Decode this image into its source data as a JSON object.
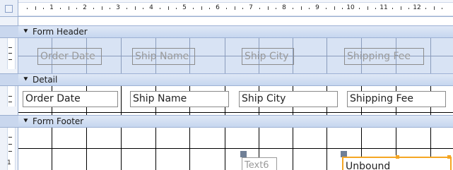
{
  "ruler": {
    "numbers": [
      "1",
      "2",
      "3",
      "4",
      "5",
      "6",
      "7",
      "8",
      "9",
      "10",
      "11",
      "12"
    ],
    "vertical_number": "1"
  },
  "sections": {
    "form_header": {
      "label": "Form Header",
      "arrow": "⯆"
    },
    "detail": {
      "label": "Detail",
      "arrow": "⯆"
    },
    "form_footer": {
      "label": "Form Footer",
      "arrow": "⯆"
    }
  },
  "header_labels": [
    "Order Date",
    "Ship Name",
    "Ship City",
    "Shipping Fee"
  ],
  "detail_fields": [
    "Order Date",
    "Ship Name",
    "Ship City",
    "Shipping Fee"
  ],
  "footer": {
    "label_text": "Text6",
    "textbox_text": "Unbound"
  },
  "colors": {
    "section_bar": "#c6d6ef",
    "selection": "#f5a623",
    "header_bg": "#d8e3f4"
  }
}
